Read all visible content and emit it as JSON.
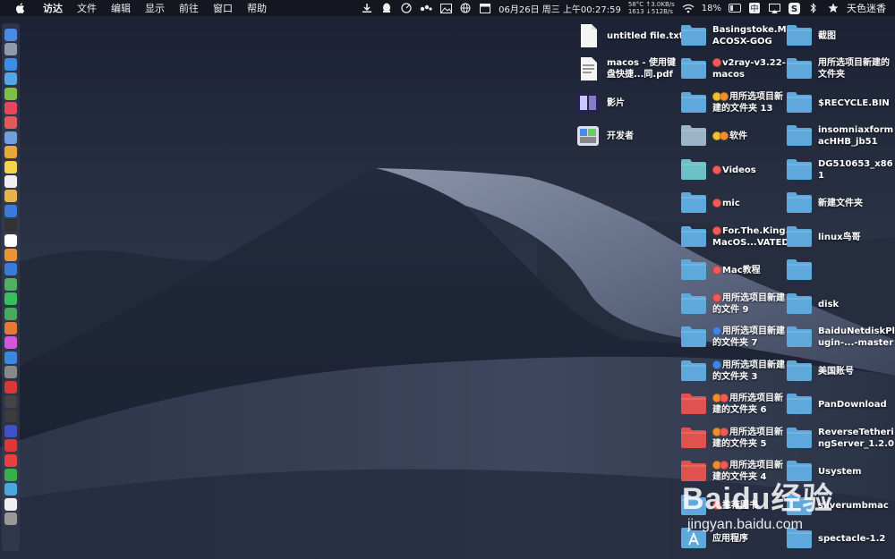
{
  "menubar": {
    "menus": [
      "访达",
      "文件",
      "编辑",
      "显示",
      "前往",
      "窗口",
      "帮助"
    ],
    "clock": "06月26日 周三 上午00:27:59",
    "stats_line1": "58°C ↑3.0KB/s",
    "stats_line2": "1613 ↓512B/s",
    "battery": "18%",
    "input_method": "中",
    "user": "天色迷香"
  },
  "desktop": {
    "items": [
      {
        "label": "untitled file.txt",
        "type": "document",
        "tags": []
      },
      {
        "label": "macos - 使用键盘快捷...同.pdf",
        "type": "pdf",
        "tags": []
      },
      {
        "label": "影片",
        "type": "movie",
        "tags": []
      },
      {
        "label": "开发者",
        "type": "developer",
        "tags": []
      },
      {
        "label": "Basingstoke.MACOSX-GOG",
        "type": "folder",
        "tags": []
      },
      {
        "label": "v2ray-v3.22-macos",
        "type": "folder",
        "tags": [
          "red"
        ]
      },
      {
        "label": "用所选项目新建的文件夹 13",
        "type": "folder",
        "tags": [
          "yellow",
          "orange"
        ]
      },
      {
        "label": "软件",
        "type": "folder-light",
        "tags": [
          "yellow",
          "orange"
        ]
      },
      {
        "label": "Videos",
        "type": "folder-teal",
        "tags": [
          "red"
        ]
      },
      {
        "label": "mic",
        "type": "folder",
        "tags": [
          "red"
        ]
      },
      {
        "label": "For.The.King.MacOS...VATED",
        "type": "folder",
        "tags": [
          "red"
        ]
      },
      {
        "label": "Mac教程",
        "type": "folder",
        "tags": [
          "red"
        ]
      },
      {
        "label": "用所选项目新建的文件 9",
        "type": "folder",
        "tags": [
          "red"
        ]
      },
      {
        "label": "用所选项目新建的文件夹 7",
        "type": "folder",
        "tags": [
          "blue"
        ]
      },
      {
        "label": "用所选项目新建的文件夹 3",
        "type": "folder",
        "tags": [
          "blue"
        ]
      },
      {
        "label": "用所选项目新建的文件夹 6",
        "type": "folder-red",
        "tags": [
          "orange",
          "red"
        ]
      },
      {
        "label": "用所选项目新建的文件夹 5",
        "type": "folder-red",
        "tags": [
          "orange",
          "red"
        ]
      },
      {
        "label": "用所选项目新建的文件夹 4",
        "type": "folder-red",
        "tags": [
          "orange",
          "red"
        ]
      },
      {
        "label": "推荐图书",
        "type": "folder",
        "tags": [
          "red"
        ]
      },
      {
        "label": "应用程序",
        "type": "apps",
        "tags": []
      },
      {
        "label": "截图",
        "type": "folder",
        "tags": []
      },
      {
        "label": "用所选项目新建的文件夹",
        "type": "folder",
        "tags": []
      },
      {
        "label": "$RECYCLE.BIN",
        "type": "folder",
        "tags": []
      },
      {
        "label": "insomniaxformacHHB_jb51",
        "type": "folder",
        "tags": []
      },
      {
        "label": "DG510653_x861",
        "type": "folder",
        "tags": []
      },
      {
        "label": "新建文件夹",
        "type": "folder",
        "tags": []
      },
      {
        "label": "linux鸟哥",
        "type": "folder",
        "tags": []
      },
      {
        "label": "",
        "type": "folder",
        "tags": []
      },
      {
        "label": "disk",
        "type": "folder",
        "tags": []
      },
      {
        "label": "BaiduNetdiskPlugin-...-master",
        "type": "folder",
        "tags": []
      },
      {
        "label": "美国账号",
        "type": "folder",
        "tags": []
      },
      {
        "label": "PanDownload",
        "type": "folder",
        "tags": []
      },
      {
        "label": "ReverseTetheringServer_1.2.0",
        "type": "folder",
        "tags": []
      },
      {
        "label": "Usystem",
        "type": "folder",
        "tags": []
      },
      {
        "label": "sliverumbmac",
        "type": "folder",
        "tags": []
      },
      {
        "label": "spectacle-1.2",
        "type": "folder",
        "tags": []
      }
    ]
  },
  "watermark": {
    "brand": "Baidu经验",
    "url": "jingyan.baidu.com"
  },
  "colors": {
    "folder": "#5fa8dc",
    "folder_red": "#e0524f",
    "folder_teal": "#6cc0c6",
    "tag_red": "#f25a55",
    "tag_yellow": "#f2c12e",
    "tag_orange": "#f28e2b",
    "tag_blue": "#3f86e8"
  }
}
